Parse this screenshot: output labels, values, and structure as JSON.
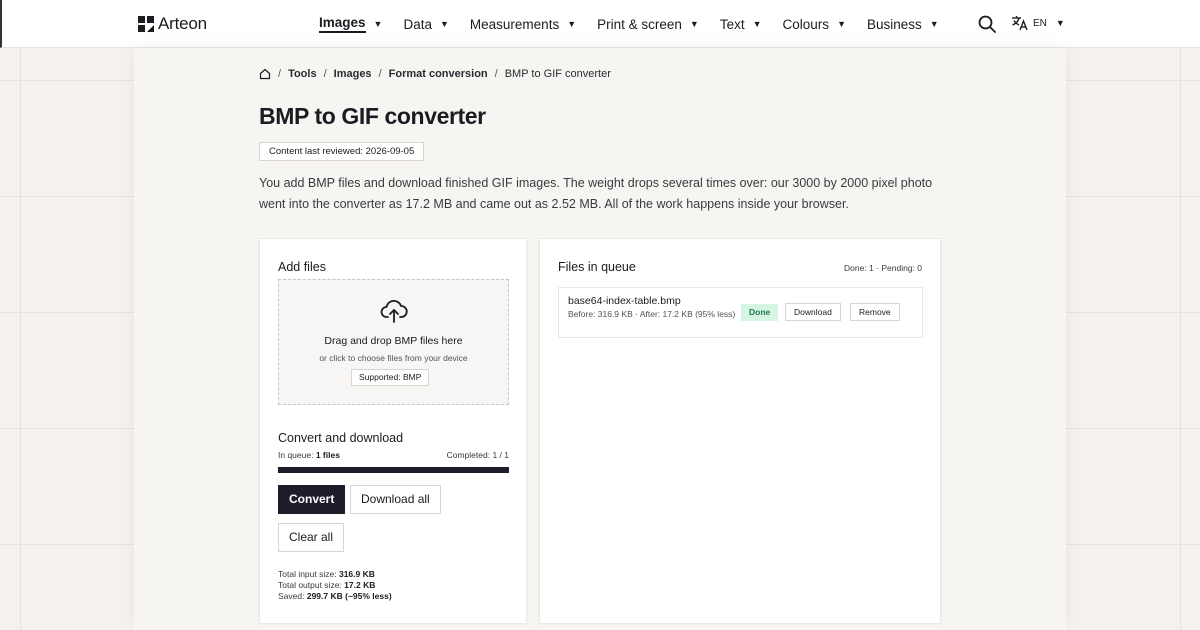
{
  "brand": {
    "name": "Arteon"
  },
  "nav": {
    "items": [
      {
        "label": "Images",
        "active": true
      },
      {
        "label": "Data"
      },
      {
        "label": "Measurements"
      },
      {
        "label": "Print & screen"
      },
      {
        "label": "Text"
      },
      {
        "label": "Colours"
      },
      {
        "label": "Business"
      }
    ],
    "caret": "▼",
    "language": "EN"
  },
  "breadcrumb": {
    "separator": "/",
    "items": [
      "Tools",
      "Images",
      "Format conversion"
    ],
    "current": "BMP to GIF converter"
  },
  "page": {
    "title": "BMP to GIF converter",
    "reviewed_label": "Content last reviewed:",
    "reviewed_date": "2026-09-05",
    "intro": "You add BMP files and download finished GIF images. The weight drops several times over: our 3000 by 2000 pixel photo went into the converter as 17.2 MB and came out as 2.52 MB. All of the work happens inside your browser."
  },
  "add_files": {
    "heading": "Add files",
    "drop_title": "Drag and drop BMP files here",
    "drop_sub": "or click to choose files from your device",
    "supported": "Supported: BMP"
  },
  "convert": {
    "heading": "Convert and download",
    "in_queue_label": "In queue:",
    "in_queue_value": "1 files",
    "completed_label": "Completed:",
    "completed_value": "1 / 1",
    "progress_fraction": 1.0,
    "convert_label": "Convert",
    "download_all_label": "Download all",
    "clear_all_label": "Clear all",
    "total_input_label": "Total input size:",
    "total_input_value": "316.9 KB",
    "total_output_label": "Total output size:",
    "total_output_value": "17.2 KB",
    "saved_label": "Saved:",
    "saved_value": "299.7 KB (~95% less)"
  },
  "queue": {
    "heading": "Files in queue",
    "counts": "Done: 1 · Pending: 0",
    "files": [
      {
        "name": "base64-index-table.bmp",
        "sizes": "Before: 316.9 KB · After: 17.2 KB (95% less)",
        "status": "Done",
        "download_label": "Download",
        "remove_label": "Remove"
      }
    ]
  },
  "colors": {
    "accent_dark": "#1e1d2b",
    "status_done_bg": "#d6f5e4",
    "status_done_text": "#1f7a4c"
  }
}
